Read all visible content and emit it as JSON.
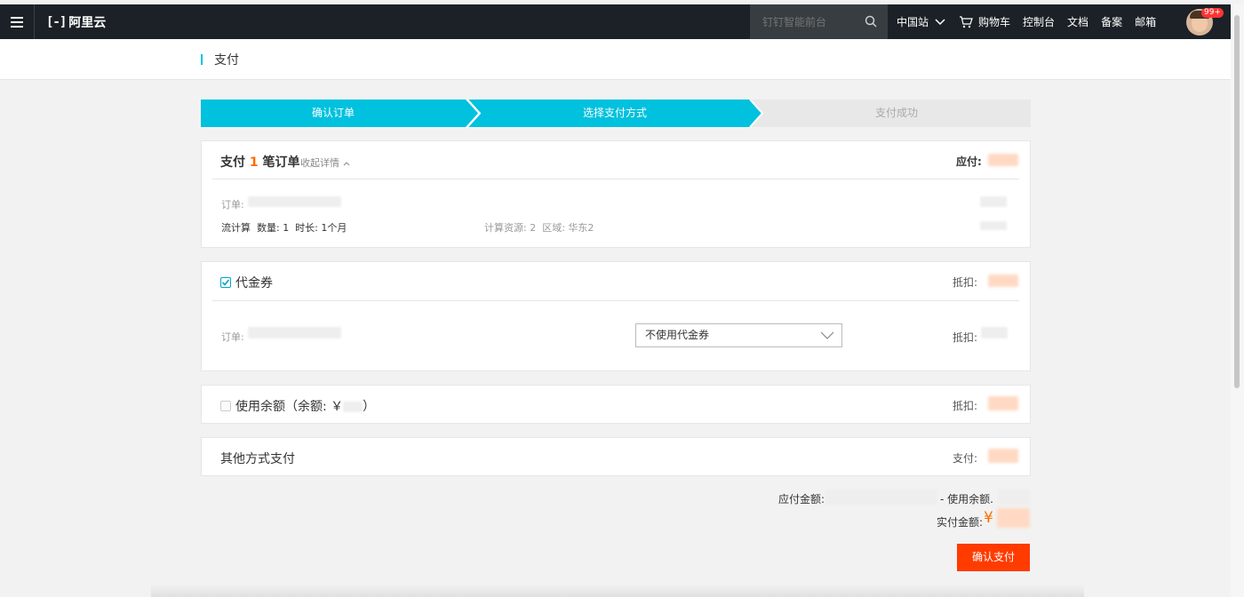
{
  "brand": {
    "logo_mark": "[-]",
    "logo_text": "阿里云"
  },
  "topnav": {
    "search_placeholder": "钉钉智能前台",
    "region": "中国站",
    "cart": "购物车",
    "console": "控制台",
    "docs": "文档",
    "filing": "备案",
    "mail": "邮箱",
    "badge": "99+"
  },
  "page": {
    "title": "支付"
  },
  "steps": [
    "确认订单",
    "选择支付方式",
    "支付成功"
  ],
  "order_card": {
    "heading_prefix": "支付",
    "count": "1",
    "heading_suffix": "笔订单",
    "toggle": "收起详情",
    "payable_label": "应付:",
    "order_label": "订单:",
    "spec": "流计算  数量: 1  时长: 1个月",
    "resource": "计算资源: 2  区域: 华东2"
  },
  "voucher_card": {
    "label": "代金券",
    "deduct_label": "抵扣:",
    "order_label": "订单:",
    "select_value": "不使用代金券",
    "row_deduct_label": "抵扣:"
  },
  "balance_card": {
    "label": "使用余额（余额: ￥",
    "suffix": "）",
    "deduct_label": "抵扣:"
  },
  "other_card": {
    "label": "其他方式支付",
    "pay_label": "支付:"
  },
  "summary": {
    "payable": "应付金额:",
    "minus_balance": "- 使用余额.",
    "actual": "实付金额:",
    "currency": "¥"
  },
  "pay_button": "确认支付",
  "colors": {
    "accent": "#00c1de",
    "orange": "#ff6a00",
    "pay_button": "#ff3b00",
    "topbar": "#1b2126"
  }
}
